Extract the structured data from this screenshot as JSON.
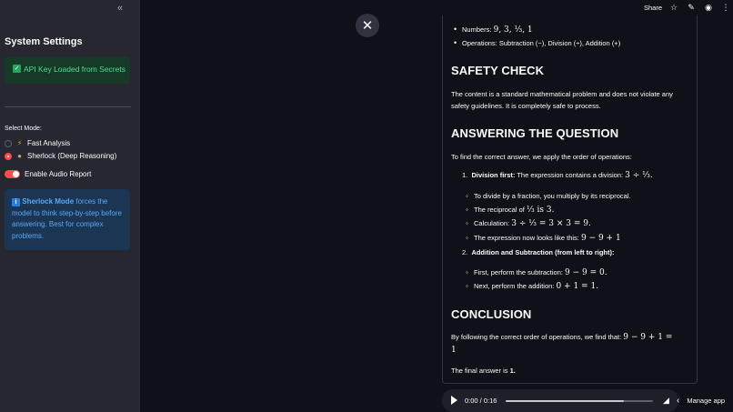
{
  "sidebar": {
    "collapse_icon": "double-chevron-left-icon",
    "title": "System Settings",
    "api_status": "API Key Loaded from Secrets",
    "mode_label": "Select Mode:",
    "modes": [
      {
        "label": "Fast Analysis",
        "icon": "lightning-icon",
        "selected": false
      },
      {
        "label": "Sherlock (Deep Reasoning)",
        "icon": "detective-icon",
        "selected": true
      }
    ],
    "audio_toggle_label": "Enable Audio Report",
    "audio_toggle_on": true,
    "info": {
      "bold": "Sherlock Mode",
      "text": " forces the model to think step-by-step before answering. Best for complex problems."
    }
  },
  "toolbar": {
    "share": "Share",
    "icons": [
      "star-icon",
      "edit-icon",
      "github-icon",
      "more-icon"
    ]
  },
  "content": {
    "bullets": [
      {
        "prefix": "Numbers: ",
        "math": "9, 3, ⅓, 1"
      },
      {
        "prefix": "Operations: Subtraction (−), Division (÷), Addition (+)",
        "math": ""
      }
    ],
    "h_safety": "SAFETY CHECK",
    "safety_text": "The content is a standard mathematical problem and does not violate any safety guidelines. It is completely safe to process.",
    "h_answer": "ANSWERING THE QUESTION",
    "answer_intro": "To find the correct answer, we apply the order of operations:",
    "step1_title": "Division first:",
    "step1_text": " The expression contains a division: ",
    "step1_math": "3 ÷ ⅓.",
    "step1_subs": [
      {
        "text": "To divide by a fraction, you multiply by its reciprocal.",
        "math": ""
      },
      {
        "text": "The reciprocal of ",
        "math": "⅓ is 3."
      },
      {
        "text": "Calculation: ",
        "math": "3 ÷ ⅓ = 3 × 3 = 9."
      },
      {
        "text": "The expression now looks like this: ",
        "math": "9 − 9 + 1"
      }
    ],
    "step2_title": "Addition and Subtraction (from left to right):",
    "step2_subs": [
      {
        "text": "First, perform the subtraction: ",
        "math": "9 − 9 = 0."
      },
      {
        "text": "Next, perform the addition: ",
        "math": "0 + 1 = 1."
      }
    ],
    "h_conclusion": "CONCLUSION",
    "conclusion_text": "By following the correct order of operations, we find that: ",
    "conclusion_math1": "9 − 9 + 1 =",
    "conclusion_math2": "1",
    "final_prefix": "The final answer is ",
    "final_value": "1."
  },
  "audio": {
    "time": "0:00 / 0:16",
    "progress": 0.8
  },
  "manage": "Manage app"
}
